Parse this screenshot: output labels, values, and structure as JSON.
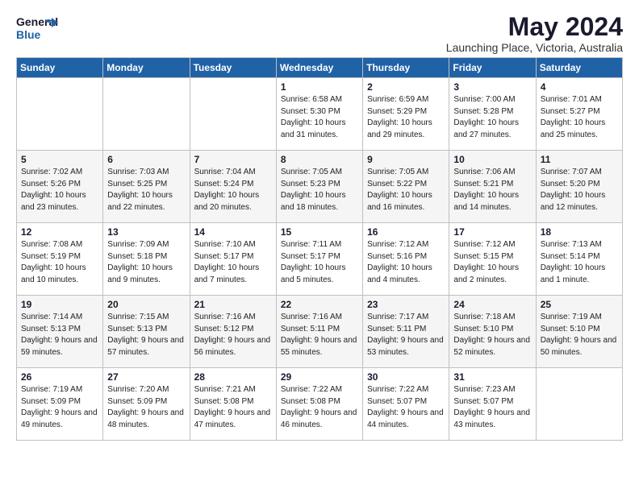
{
  "logo": {
    "general": "General",
    "blue": "Blue"
  },
  "title": "May 2024",
  "location": "Launching Place, Victoria, Australia",
  "headers": [
    "Sunday",
    "Monday",
    "Tuesday",
    "Wednesday",
    "Thursday",
    "Friday",
    "Saturday"
  ],
  "weeks": [
    [
      {
        "day": "",
        "sunrise": "",
        "sunset": "",
        "daylight": ""
      },
      {
        "day": "",
        "sunrise": "",
        "sunset": "",
        "daylight": ""
      },
      {
        "day": "",
        "sunrise": "",
        "sunset": "",
        "daylight": ""
      },
      {
        "day": "1",
        "sunrise": "Sunrise: 6:58 AM",
        "sunset": "Sunset: 5:30 PM",
        "daylight": "Daylight: 10 hours and 31 minutes."
      },
      {
        "day": "2",
        "sunrise": "Sunrise: 6:59 AM",
        "sunset": "Sunset: 5:29 PM",
        "daylight": "Daylight: 10 hours and 29 minutes."
      },
      {
        "day": "3",
        "sunrise": "Sunrise: 7:00 AM",
        "sunset": "Sunset: 5:28 PM",
        "daylight": "Daylight: 10 hours and 27 minutes."
      },
      {
        "day": "4",
        "sunrise": "Sunrise: 7:01 AM",
        "sunset": "Sunset: 5:27 PM",
        "daylight": "Daylight: 10 hours and 25 minutes."
      }
    ],
    [
      {
        "day": "5",
        "sunrise": "Sunrise: 7:02 AM",
        "sunset": "Sunset: 5:26 PM",
        "daylight": "Daylight: 10 hours and 23 minutes."
      },
      {
        "day": "6",
        "sunrise": "Sunrise: 7:03 AM",
        "sunset": "Sunset: 5:25 PM",
        "daylight": "Daylight: 10 hours and 22 minutes."
      },
      {
        "day": "7",
        "sunrise": "Sunrise: 7:04 AM",
        "sunset": "Sunset: 5:24 PM",
        "daylight": "Daylight: 10 hours and 20 minutes."
      },
      {
        "day": "8",
        "sunrise": "Sunrise: 7:05 AM",
        "sunset": "Sunset: 5:23 PM",
        "daylight": "Daylight: 10 hours and 18 minutes."
      },
      {
        "day": "9",
        "sunrise": "Sunrise: 7:05 AM",
        "sunset": "Sunset: 5:22 PM",
        "daylight": "Daylight: 10 hours and 16 minutes."
      },
      {
        "day": "10",
        "sunrise": "Sunrise: 7:06 AM",
        "sunset": "Sunset: 5:21 PM",
        "daylight": "Daylight: 10 hours and 14 minutes."
      },
      {
        "day": "11",
        "sunrise": "Sunrise: 7:07 AM",
        "sunset": "Sunset: 5:20 PM",
        "daylight": "Daylight: 10 hours and 12 minutes."
      }
    ],
    [
      {
        "day": "12",
        "sunrise": "Sunrise: 7:08 AM",
        "sunset": "Sunset: 5:19 PM",
        "daylight": "Daylight: 10 hours and 10 minutes."
      },
      {
        "day": "13",
        "sunrise": "Sunrise: 7:09 AM",
        "sunset": "Sunset: 5:18 PM",
        "daylight": "Daylight: 10 hours and 9 minutes."
      },
      {
        "day": "14",
        "sunrise": "Sunrise: 7:10 AM",
        "sunset": "Sunset: 5:17 PM",
        "daylight": "Daylight: 10 hours and 7 minutes."
      },
      {
        "day": "15",
        "sunrise": "Sunrise: 7:11 AM",
        "sunset": "Sunset: 5:17 PM",
        "daylight": "Daylight: 10 hours and 5 minutes."
      },
      {
        "day": "16",
        "sunrise": "Sunrise: 7:12 AM",
        "sunset": "Sunset: 5:16 PM",
        "daylight": "Daylight: 10 hours and 4 minutes."
      },
      {
        "day": "17",
        "sunrise": "Sunrise: 7:12 AM",
        "sunset": "Sunset: 5:15 PM",
        "daylight": "Daylight: 10 hours and 2 minutes."
      },
      {
        "day": "18",
        "sunrise": "Sunrise: 7:13 AM",
        "sunset": "Sunset: 5:14 PM",
        "daylight": "Daylight: 10 hours and 1 minute."
      }
    ],
    [
      {
        "day": "19",
        "sunrise": "Sunrise: 7:14 AM",
        "sunset": "Sunset: 5:13 PM",
        "daylight": "Daylight: 9 hours and 59 minutes."
      },
      {
        "day": "20",
        "sunrise": "Sunrise: 7:15 AM",
        "sunset": "Sunset: 5:13 PM",
        "daylight": "Daylight: 9 hours and 57 minutes."
      },
      {
        "day": "21",
        "sunrise": "Sunrise: 7:16 AM",
        "sunset": "Sunset: 5:12 PM",
        "daylight": "Daylight: 9 hours and 56 minutes."
      },
      {
        "day": "22",
        "sunrise": "Sunrise: 7:16 AM",
        "sunset": "Sunset: 5:11 PM",
        "daylight": "Daylight: 9 hours and 55 minutes."
      },
      {
        "day": "23",
        "sunrise": "Sunrise: 7:17 AM",
        "sunset": "Sunset: 5:11 PM",
        "daylight": "Daylight: 9 hours and 53 minutes."
      },
      {
        "day": "24",
        "sunrise": "Sunrise: 7:18 AM",
        "sunset": "Sunset: 5:10 PM",
        "daylight": "Daylight: 9 hours and 52 minutes."
      },
      {
        "day": "25",
        "sunrise": "Sunrise: 7:19 AM",
        "sunset": "Sunset: 5:10 PM",
        "daylight": "Daylight: 9 hours and 50 minutes."
      }
    ],
    [
      {
        "day": "26",
        "sunrise": "Sunrise: 7:19 AM",
        "sunset": "Sunset: 5:09 PM",
        "daylight": "Daylight: 9 hours and 49 minutes."
      },
      {
        "day": "27",
        "sunrise": "Sunrise: 7:20 AM",
        "sunset": "Sunset: 5:09 PM",
        "daylight": "Daylight: 9 hours and 48 minutes."
      },
      {
        "day": "28",
        "sunrise": "Sunrise: 7:21 AM",
        "sunset": "Sunset: 5:08 PM",
        "daylight": "Daylight: 9 hours and 47 minutes."
      },
      {
        "day": "29",
        "sunrise": "Sunrise: 7:22 AM",
        "sunset": "Sunset: 5:08 PM",
        "daylight": "Daylight: 9 hours and 46 minutes."
      },
      {
        "day": "30",
        "sunrise": "Sunrise: 7:22 AM",
        "sunset": "Sunset: 5:07 PM",
        "daylight": "Daylight: 9 hours and 44 minutes."
      },
      {
        "day": "31",
        "sunrise": "Sunrise: 7:23 AM",
        "sunset": "Sunset: 5:07 PM",
        "daylight": "Daylight: 9 hours and 43 minutes."
      },
      {
        "day": "",
        "sunrise": "",
        "sunset": "",
        "daylight": ""
      }
    ]
  ]
}
